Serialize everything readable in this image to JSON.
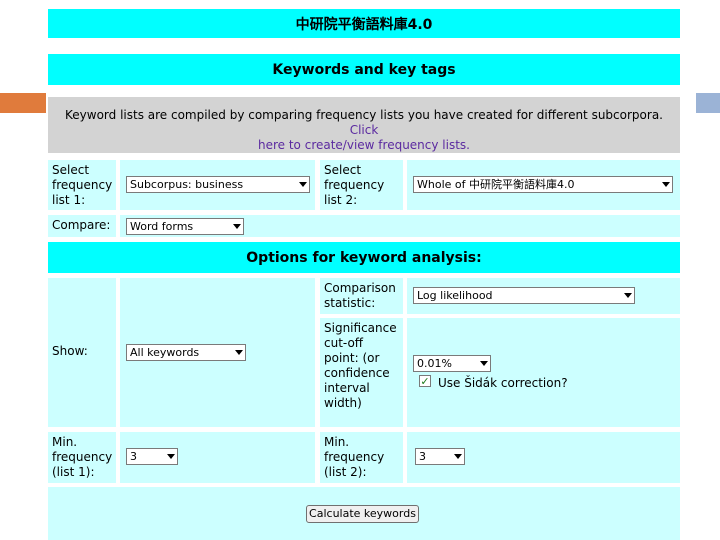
{
  "header": {
    "title": "中研院平衡語料庫4.0"
  },
  "section1": {
    "title": "Keywords and key tags"
  },
  "info": {
    "text": "Keyword lists are compiled by comparing frequency lists you have created for different subcorpora.",
    "link_text_1": "Click",
    "link_text_2": "here to create/view frequency lists."
  },
  "form": {
    "freq_list_1_label": "Select frequency list 1:",
    "freq_list_1_value": "Subcorpus: business",
    "freq_list_2_label": "Select frequency list 2:",
    "freq_list_2_value": "Whole of 中研院平衡語料庫4.0",
    "compare_label": "Compare:",
    "compare_value": "Word forms"
  },
  "options": {
    "title": "Options for keyword analysis:",
    "show_label": "Show:",
    "show_value": "All keywords",
    "comparison_label": "Comparison statistic:",
    "comparison_value": "Log likelihood",
    "significance_label": "Significance cut-off point: (or confidence interval width)",
    "significance_value": "0.01%",
    "sidak_label": "Use Šidák correction?",
    "sidak_checked": "✓",
    "min_freq_1_label": "Min. frequency (list 1):",
    "min_freq_1_value": "3",
    "min_freq_2_label": "Min. frequency (list 2):",
    "min_freq_2_value": "3",
    "calculate_label": "Calculate keywords"
  }
}
